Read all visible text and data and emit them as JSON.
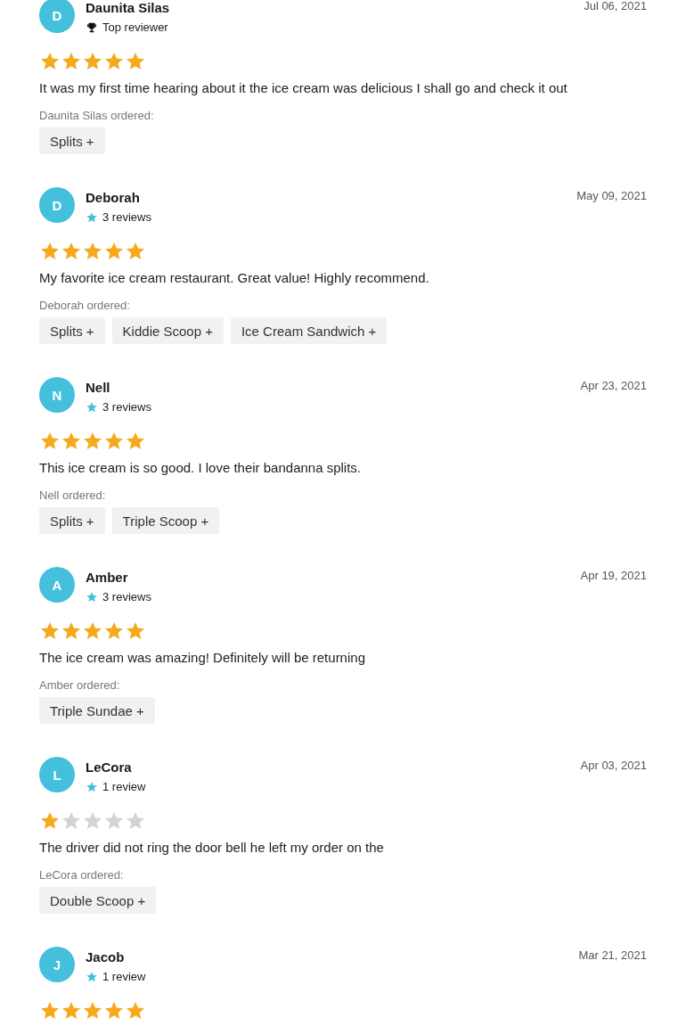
{
  "reviews": [
    {
      "initial": "D",
      "name": "Daunita Silas",
      "badge": {
        "kind": "top_reviewer",
        "text": "Top reviewer"
      },
      "date": "Jul 06, 2021",
      "stars": 5,
      "text": "It was my first time hearing about it the ice cream was delicious I shall go and check it out",
      "ordered_label": "Daunita Silas ordered:",
      "items": [
        "Splits +"
      ]
    },
    {
      "initial": "D",
      "name": "Deborah",
      "badge": {
        "kind": "reviews",
        "text": "3 reviews"
      },
      "date": "May 09, 2021",
      "stars": 5,
      "text": "My favorite ice cream restaurant. Great value! Highly recommend.",
      "ordered_label": "Deborah ordered:",
      "items": [
        "Splits +",
        "Kiddie Scoop +",
        "Ice Cream Sandwich +"
      ]
    },
    {
      "initial": "N",
      "name": "Nell",
      "badge": {
        "kind": "reviews",
        "text": "3 reviews"
      },
      "date": "Apr 23, 2021",
      "stars": 5,
      "text": "This ice cream is so good. I love their bandanna splits.",
      "ordered_label": "Nell ordered:",
      "items": [
        "Splits +",
        "Triple Scoop +"
      ]
    },
    {
      "initial": "A",
      "name": "Amber",
      "badge": {
        "kind": "reviews",
        "text": "3 reviews"
      },
      "date": "Apr 19, 2021",
      "stars": 5,
      "text": "The ice cream was amazing! Definitely will be returning",
      "ordered_label": "Amber ordered:",
      "items": [
        "Triple Sundae +"
      ]
    },
    {
      "initial": "L",
      "name": "LeCora",
      "badge": {
        "kind": "reviews",
        "text": "1 review"
      },
      "date": "Apr 03, 2021",
      "stars": 1,
      "text": "The driver did not ring the door bell he left my order on the",
      "ordered_label": "LeCora ordered:",
      "items": [
        "Double Scoop +"
      ]
    },
    {
      "initial": "J",
      "name": "Jacob",
      "badge": {
        "kind": "reviews",
        "text": "1 review"
      },
      "date": "Mar 21, 2021",
      "stars": 5
    }
  ]
}
